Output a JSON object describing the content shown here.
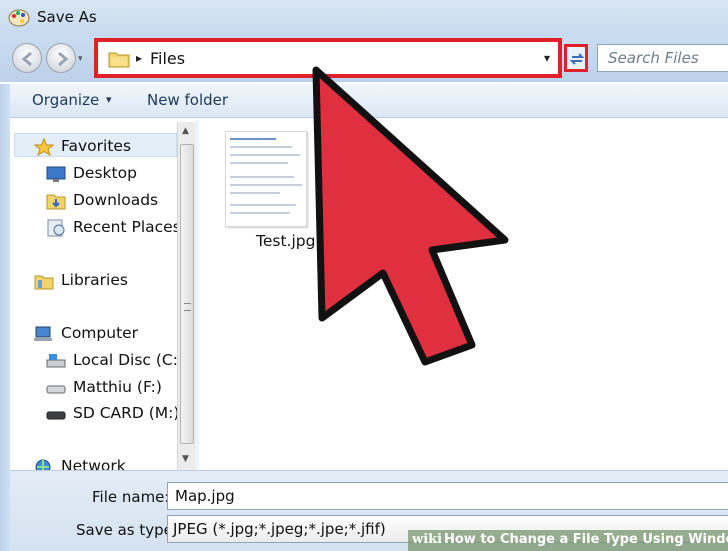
{
  "window": {
    "title": "Save As"
  },
  "address": {
    "crumb_arrow": "▸",
    "folder": "Files",
    "dropdown_glyph": "▾"
  },
  "search": {
    "placeholder": "Search Files"
  },
  "toolbar": {
    "organize": "Organize",
    "organize_caret": "▾",
    "new_folder": "New folder"
  },
  "nav": {
    "favorites": "Favorites",
    "desktop": "Desktop",
    "downloads": "Downloads",
    "recent_places": "Recent Places",
    "libraries": "Libraries",
    "computer": "Computer",
    "local_disc": "Local Disc (C:)",
    "matthiu": "Matthiu (F:)",
    "sd_card": "SD CARD (M:)",
    "network": "Network"
  },
  "files": [
    {
      "name": "Test.jpg"
    }
  ],
  "form": {
    "file_name_label": "File name:",
    "file_name_value": "Map.jpg",
    "save_type_label": "Save as type:",
    "save_type_value": "JPEG (*.jpg;*.jpeg;*.jpe;*.jfif)"
  },
  "watermark": {
    "brand": "wiki",
    "text": "How to Change a File Type Using Windows"
  },
  "colors": {
    "highlight_red": "#e0202b",
    "arrow_red": "#e02f3f"
  },
  "icons": [
    "paint-app-icon",
    "back-icon",
    "forward-icon",
    "folder-icon",
    "refresh-icon",
    "star-icon",
    "desktop-icon",
    "downloads-icon",
    "recent-places-icon",
    "libraries-icon",
    "computer-icon",
    "drive-icon",
    "usb-drive-icon",
    "sd-card-icon",
    "network-icon"
  ]
}
